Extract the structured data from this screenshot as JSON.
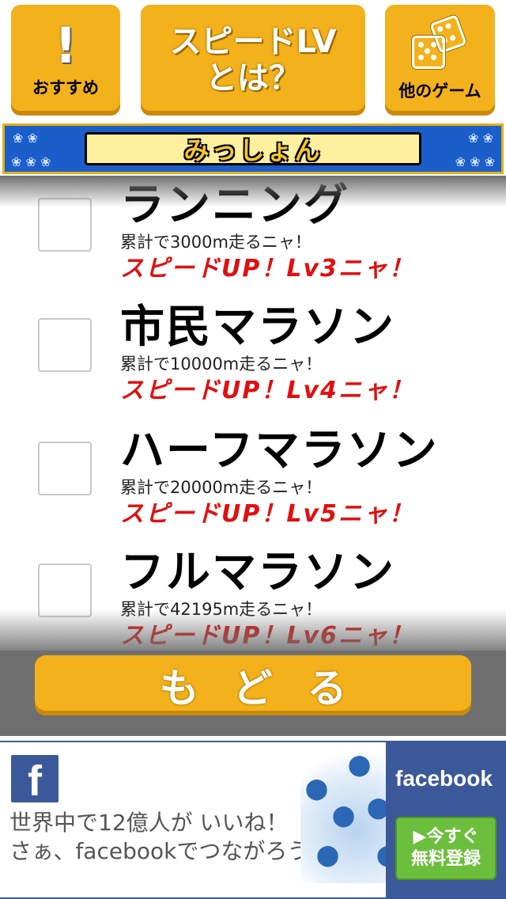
{
  "header": {
    "osusume_label": "おすすめ",
    "speed_line1": "スピードLV",
    "speed_line2": "とは？",
    "other_games_label": "他のゲーム"
  },
  "mission_header": {
    "title": "みっしょん"
  },
  "missions": [
    {
      "title": "ランニング",
      "description": "累計で3000m走るニャ！",
      "reward": "スピードUP！Lv3ニャ！"
    },
    {
      "title": "市民マラソン",
      "description": "累計で10000m走るニャ！",
      "reward": "スピードUP！Lv4ニャ！"
    },
    {
      "title": "ハーフマラソン",
      "description": "累計で20000m走るニャ！",
      "reward": "スピードUP！Lv5ニャ！"
    },
    {
      "title": "フルマラソン",
      "description": "累計で42195m走るニャ！",
      "reward": "スピードUP！Lv6ニャ！"
    }
  ],
  "back_button": {
    "label": "もどる"
  },
  "ad": {
    "logo_letter": "f",
    "line1": "世界中で12億人が いいね！",
    "line2": "さぁ、facebookでつながろう",
    "brand": "facebook",
    "cta_line1": "▶今すぐ",
    "cta_line2": "無料登録"
  },
  "colors": {
    "button_orange": "#f3b21b",
    "header_blue": "#1b5ec9",
    "reward_red": "#e01010",
    "facebook_blue": "#3b5998",
    "cta_green": "#6cbf3c"
  }
}
